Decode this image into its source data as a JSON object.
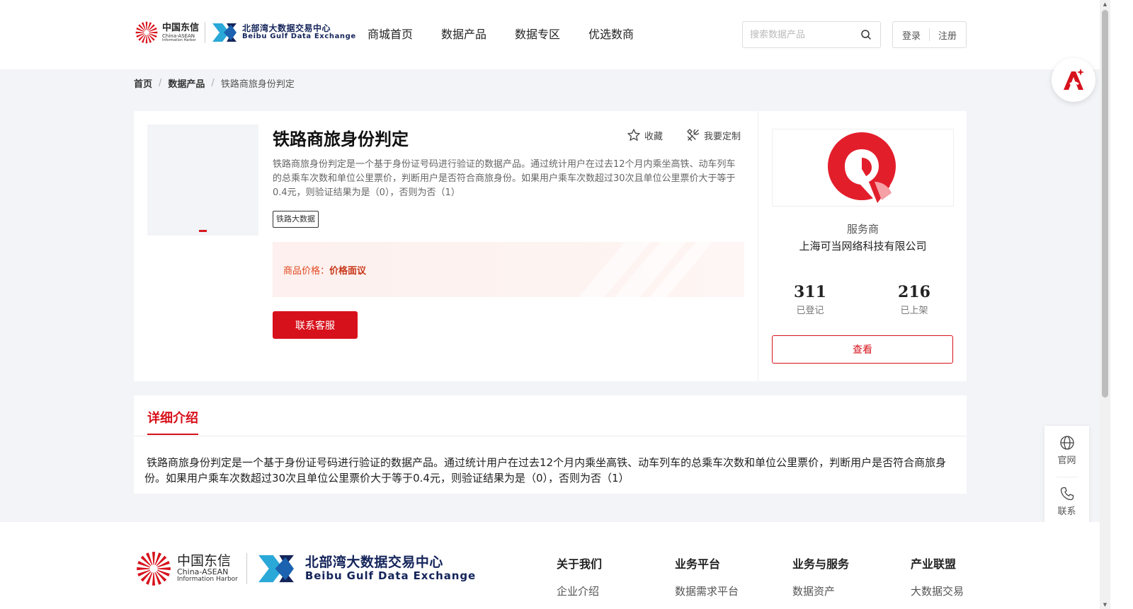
{
  "header": {
    "brand_cd_cn": "中国东信",
    "brand_cd_en": "China-ASEAN",
    "brand_cd_en2": "Information Harbor",
    "brand_bg_cn": "北部湾大数据交易中心",
    "brand_bg_en": "Beibu Gulf Data Exchange",
    "nav": [
      "商城首页",
      "数据产品",
      "数据专区",
      "优选数商"
    ],
    "search_placeholder": "搜索数据产品",
    "login": "登录",
    "register": "注册"
  },
  "breadcrumb": [
    "首页",
    "数据产品",
    "铁路商旅身份判定"
  ],
  "product": {
    "title": "铁路商旅身份判定",
    "favorite": "收藏",
    "customize": "我要定制",
    "description": "铁路商旅身份判定是一个基于身份证号码进行验证的数据产品。通过统计用户在过去12个月内乘坐高铁、动车列车的总乘车次数和单位公里票价，判断用户是否符合商旅身份。如果用户乘车次数超过30次且单位公里票价大于等于0.4元，则验证结果为是（0），否则为否（1）",
    "tag": "铁路大数据",
    "price_label": "商品价格：",
    "price_value": "价格面议",
    "contact_btn": "联系客服"
  },
  "vendor": {
    "role": "服务商",
    "name": "上海可当网络科技有限公司",
    "stat1_value": "311",
    "stat1_label": "已登记",
    "stat2_value": "216",
    "stat2_label": "已上架",
    "view_btn": "查看"
  },
  "detail": {
    "tab": "详细介绍",
    "text": "铁路商旅身份判定是一个基于身份证号码进行验证的数据产品。通过统计用户在过去12个月内乘坐高铁、动车列车的总乘车次数和单位公里票价，判断用户是否符合商旅身份。如果用户乘车次数超过30次且单位公里票价大于等于0.4元，则验证结果为是（0），否则为否（1）"
  },
  "side": {
    "official": "官网",
    "contact": "联系"
  },
  "footer": {
    "brand_cd_cn": "中国东信",
    "brand_cd_en": "China-ASEAN",
    "brand_cd_en2": "Information Harbor",
    "brand_bg_cn": "北部湾大数据交易中心",
    "brand_bg_en": "Beibu Gulf Data Exchange",
    "columns": [
      {
        "title": "关于我们",
        "link": "企业介绍"
      },
      {
        "title": "业务平台",
        "link": "数据需求平台"
      },
      {
        "title": "业务与服务",
        "link": "数据资产"
      },
      {
        "title": "产业联盟",
        "link": "大数据交易"
      }
    ]
  },
  "colors": {
    "accent": "#d7111b",
    "price": "#e0481f",
    "page_bg": "#f3f4f7",
    "brand_navy": "#14245a"
  }
}
